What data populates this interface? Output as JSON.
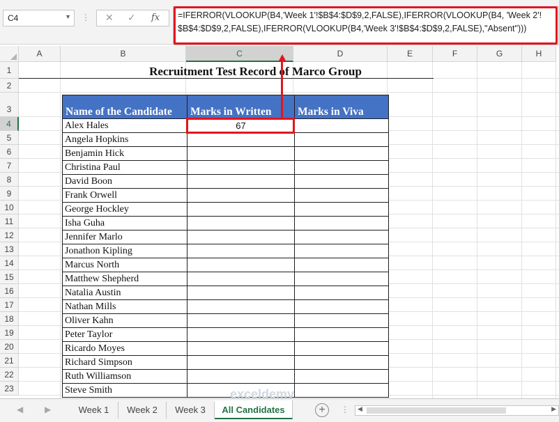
{
  "name_box": {
    "value": "C4"
  },
  "formula_bar": {
    "cancel_glyph": "✕",
    "enter_glyph": "✓",
    "fx_label": "fx",
    "line1": "=IFERROR(VLOOKUP(B4,'Week 1'!$B$4:$D$9,2,FALSE),IFERROR(VLOOKUP(B4, 'Week 2'!",
    "line2": "$B$4:$D$9,2,FALSE),IFERROR(VLOOKUP(B4,'Week 3'!$B$4:$D$9,2,FALSE),\"Absent\")))"
  },
  "columns": [
    "A",
    "B",
    "C",
    "D",
    "E",
    "F",
    "G",
    "H"
  ],
  "selected_column": "C",
  "rows": [
    "1",
    "2",
    "3",
    "4",
    "5",
    "6",
    "7",
    "8",
    "9",
    "10",
    "11",
    "12",
    "13",
    "14",
    "15",
    "16",
    "17",
    "18",
    "19",
    "20",
    "21",
    "22",
    "23"
  ],
  "selected_row": "4",
  "sheet": {
    "title": "Recruitment Test Record of Marco Group",
    "headers": [
      "Name of the Candidate",
      "Marks in Written",
      "Marks in Viva"
    ],
    "candidates": [
      {
        "name": "Alex Hales",
        "written": "67",
        "viva": ""
      },
      {
        "name": "Angela Hopkins",
        "written": "",
        "viva": ""
      },
      {
        "name": "Benjamin Hick",
        "written": "",
        "viva": ""
      },
      {
        "name": "Christina Paul",
        "written": "",
        "viva": ""
      },
      {
        "name": "David Boon",
        "written": "",
        "viva": ""
      },
      {
        "name": "Frank Orwell",
        "written": "",
        "viva": ""
      },
      {
        "name": "George Hockley",
        "written": "",
        "viva": ""
      },
      {
        "name": "Isha Guha",
        "written": "",
        "viva": ""
      },
      {
        "name": "Jennifer Marlo",
        "written": "",
        "viva": ""
      },
      {
        "name": "Jonathon Kipling",
        "written": "",
        "viva": ""
      },
      {
        "name": "Marcus North",
        "written": "",
        "viva": ""
      },
      {
        "name": "Matthew Shepherd",
        "written": "",
        "viva": ""
      },
      {
        "name": "Natalia Austin",
        "written": "",
        "viva": ""
      },
      {
        "name": "Nathan Mills",
        "written": "",
        "viva": ""
      },
      {
        "name": "Oliver Kahn",
        "written": "",
        "viva": ""
      },
      {
        "name": "Peter Taylor",
        "written": "",
        "viva": ""
      },
      {
        "name": "Ricardo Moyes",
        "written": "",
        "viva": ""
      },
      {
        "name": "Richard Simpson",
        "written": "",
        "viva": ""
      },
      {
        "name": "Ruth Williamson",
        "written": "",
        "viva": ""
      },
      {
        "name": "Steve Smith",
        "written": "",
        "viva": ""
      }
    ]
  },
  "tabs": [
    {
      "label": "Week 1",
      "active": false
    },
    {
      "label": "Week 2",
      "active": false
    },
    {
      "label": "Week 3",
      "active": false
    },
    {
      "label": "All Candidates",
      "active": true
    }
  ],
  "add_sheet_glyph": "+",
  "watermark_text": "exceldemy",
  "colors": {
    "header_fill": "#4472c4",
    "highlight": "#e0161e",
    "accent": "#217346"
  }
}
